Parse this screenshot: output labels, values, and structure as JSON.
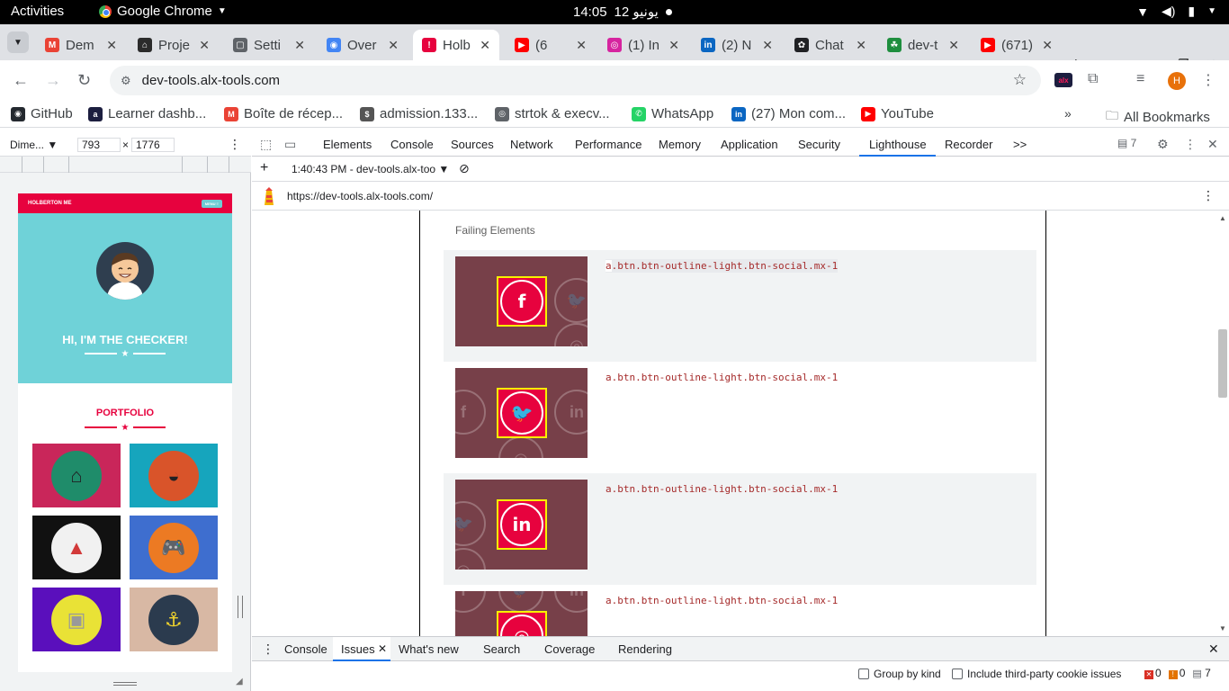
{
  "os_bar": {
    "activities": "Activities",
    "app_name": "Google Chrome",
    "clock_time": "14:05",
    "clock_date": "12 يونيو"
  },
  "tabs": [
    {
      "title": "Dem",
      "color": "#ea4335"
    },
    {
      "title": "Proje",
      "color": "#2b2b2b"
    },
    {
      "title": "Setti",
      "color": "#5f6368"
    },
    {
      "title": "Over",
      "color": "#4285f4"
    },
    {
      "title": "Holb",
      "color": "#e7023e"
    },
    {
      "title": "(6",
      "color": "#ff0000"
    },
    {
      "title": "(1) In",
      "color": "#d6249f"
    },
    {
      "title": "(2) N",
      "color": "#0a66c2"
    },
    {
      "title": "Chat",
      "color": "#202124"
    },
    {
      "title": "dev-t",
      "color": "#1e8e3e"
    },
    {
      "title": "(671)",
      "color": "#ff0000"
    }
  ],
  "address": {
    "url": "dev-tools.alx-tools.com"
  },
  "bookmarks": {
    "items": [
      "GitHub",
      "Learner dashb...",
      "Boîte de récep...",
      "admission.133...",
      "strtok & execv...",
      "WhatsApp",
      "(27) Mon com...",
      "YouTube"
    ],
    "all": "All Bookmarks"
  },
  "device": {
    "preset": "Dime...",
    "width": "793",
    "height": "1776",
    "times": "×"
  },
  "phone": {
    "brand": "HOLBERTON ME",
    "menu": "MENU ≡",
    "hero_title": "HI, I'M THE CHECKER!",
    "portfolio": "PORTFOLIO"
  },
  "devtools": {
    "tabs": [
      "Elements",
      "Console",
      "Sources",
      "Network",
      "Performance",
      "Memory",
      "Application",
      "Security",
      "Lighthouse",
      "Recorder"
    ],
    "more": ">>",
    "issues_count": "7",
    "report_time": "1:40:43 PM - dev-tools.alx-too",
    "report_url": "https://dev-tools.alx-tools.com/",
    "failing_title": "Failing Elements",
    "selectors": [
      "a.btn.btn-outline-light.btn-social.mx-1",
      "a.btn.btn-outline-light.btn-social.mx-1",
      "a.btn.btn-outline-light.btn-social.mx-1",
      "a.btn.btn-outline-light.btn-social.mx-1"
    ],
    "selector_prefix_first": "a"
  },
  "drawer": {
    "tabs": [
      "Console",
      "Issues",
      "What's new",
      "Search",
      "Coverage",
      "Rendering"
    ],
    "group_by_kind": "Group by kind",
    "third_party": "Include third-party cookie issues",
    "errors": "0",
    "warnings": "0",
    "infos": "7"
  },
  "colors": {
    "brand_red": "#e7023e",
    "hero_teal": "#6fd2d8",
    "accent_blue": "#1a73e8",
    "thumb_bg": "#774049"
  }
}
